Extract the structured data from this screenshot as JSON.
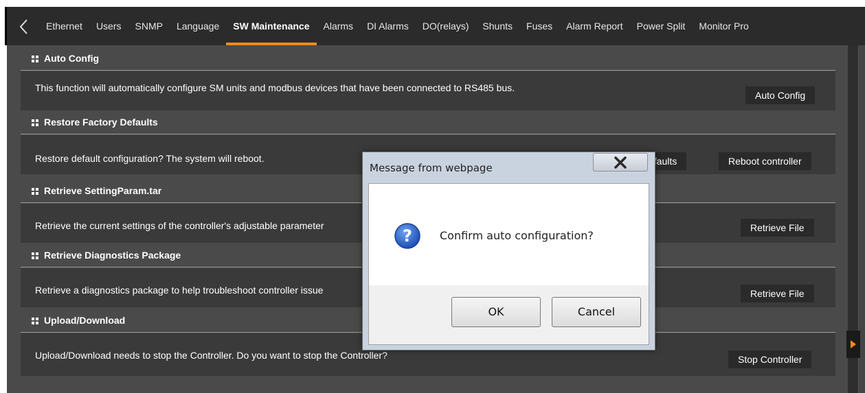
{
  "nav": {
    "back_icon": "chevron-left-icon",
    "tabs": [
      {
        "label": "Ethernet"
      },
      {
        "label": "Users"
      },
      {
        "label": "SNMP"
      },
      {
        "label": "Language"
      },
      {
        "label": "SW Maintenance",
        "active": true
      },
      {
        "label": "Alarms"
      },
      {
        "label": "DI Alarms"
      },
      {
        "label": "DO(relays)"
      },
      {
        "label": "Shunts"
      },
      {
        "label": "Fuses"
      },
      {
        "label": "Alarm Report"
      },
      {
        "label": "Power Split"
      },
      {
        "label": "Monitor Pro"
      }
    ]
  },
  "sections": [
    {
      "title": "Auto Config",
      "text": "This function will automatically configure SM units and modbus devices that have been connected to RS485 bus.",
      "buttons": [
        "Auto Config"
      ]
    },
    {
      "title": "Restore Factory Defaults",
      "text": "Restore default configuration? The system will reboot.",
      "buttons": [
        "efaults",
        "Reboot controller"
      ]
    },
    {
      "title": "Retrieve SettingParam.tar",
      "text": "Retrieve the current settings of the controller's adjustable parameter",
      "buttons": [
        "Retrieve File"
      ]
    },
    {
      "title": "Retrieve Diagnostics Package",
      "text": "Retrieve a diagnostics package to help troubleshoot controller issue",
      "buttons": [
        "Retrieve File"
      ]
    },
    {
      "title": "Upload/Download",
      "text": "Upload/Download needs to stop the Controller. Do you want to stop the Controller?",
      "buttons": [
        "Stop Controller"
      ]
    }
  ],
  "dialog": {
    "title": "Message from webpage",
    "message": "Confirm auto configuration?",
    "icon": "question-icon",
    "ok_label": "OK",
    "cancel_label": "Cancel",
    "close_icon": "close-icon"
  },
  "colors": {
    "accent": "#f28a1b",
    "nav_bg": "#2b2b2b",
    "content_bg": "#4a4a4a",
    "section_body_bg": "#3a3a3a",
    "button_bg": "#2a2a2a"
  }
}
